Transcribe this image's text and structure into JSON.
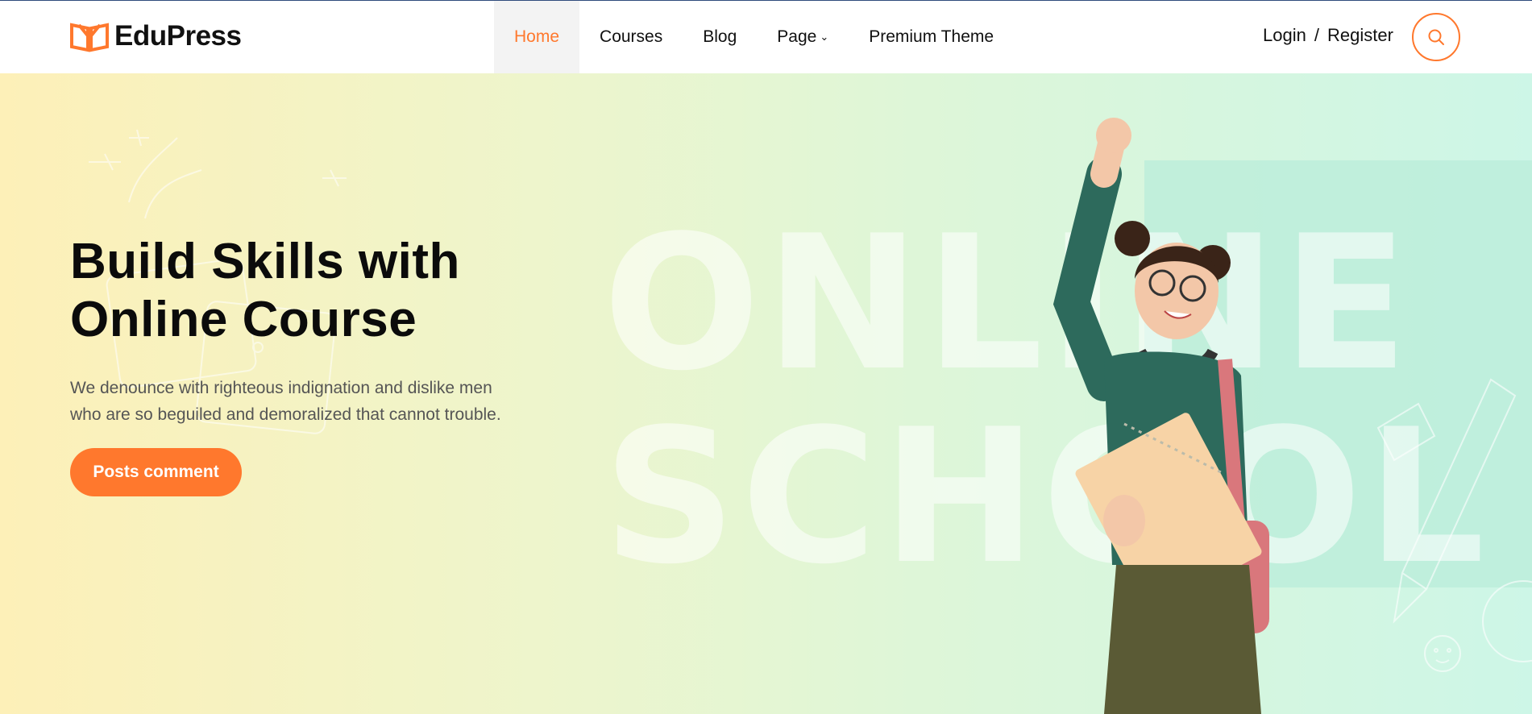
{
  "brand": {
    "name": "EduPress",
    "accent_color": "#ff782d",
    "logo_icon": "open-book-logo"
  },
  "nav": {
    "items": [
      {
        "label": "Home",
        "active": true
      },
      {
        "label": "Courses",
        "active": false
      },
      {
        "label": "Blog",
        "active": false
      },
      {
        "label": "Page",
        "active": false,
        "has_dropdown": true
      },
      {
        "label": "Premium Theme",
        "active": false
      }
    ]
  },
  "auth": {
    "login": "Login",
    "separator": "/",
    "register": "Register"
  },
  "search": {
    "icon": "search-icon"
  },
  "hero": {
    "title_line1": "Build Skills with",
    "title_line2": "Online Course",
    "description_line1": "We denounce with righteous indignation and dislike men",
    "description_line2": "who are so beguiled and demoralized that cannot trouble.",
    "cta_label": "Posts comment",
    "background_word_1": "ONLINE",
    "background_word_2": "SCHOOL",
    "image": "student-with-notebook-photo"
  }
}
